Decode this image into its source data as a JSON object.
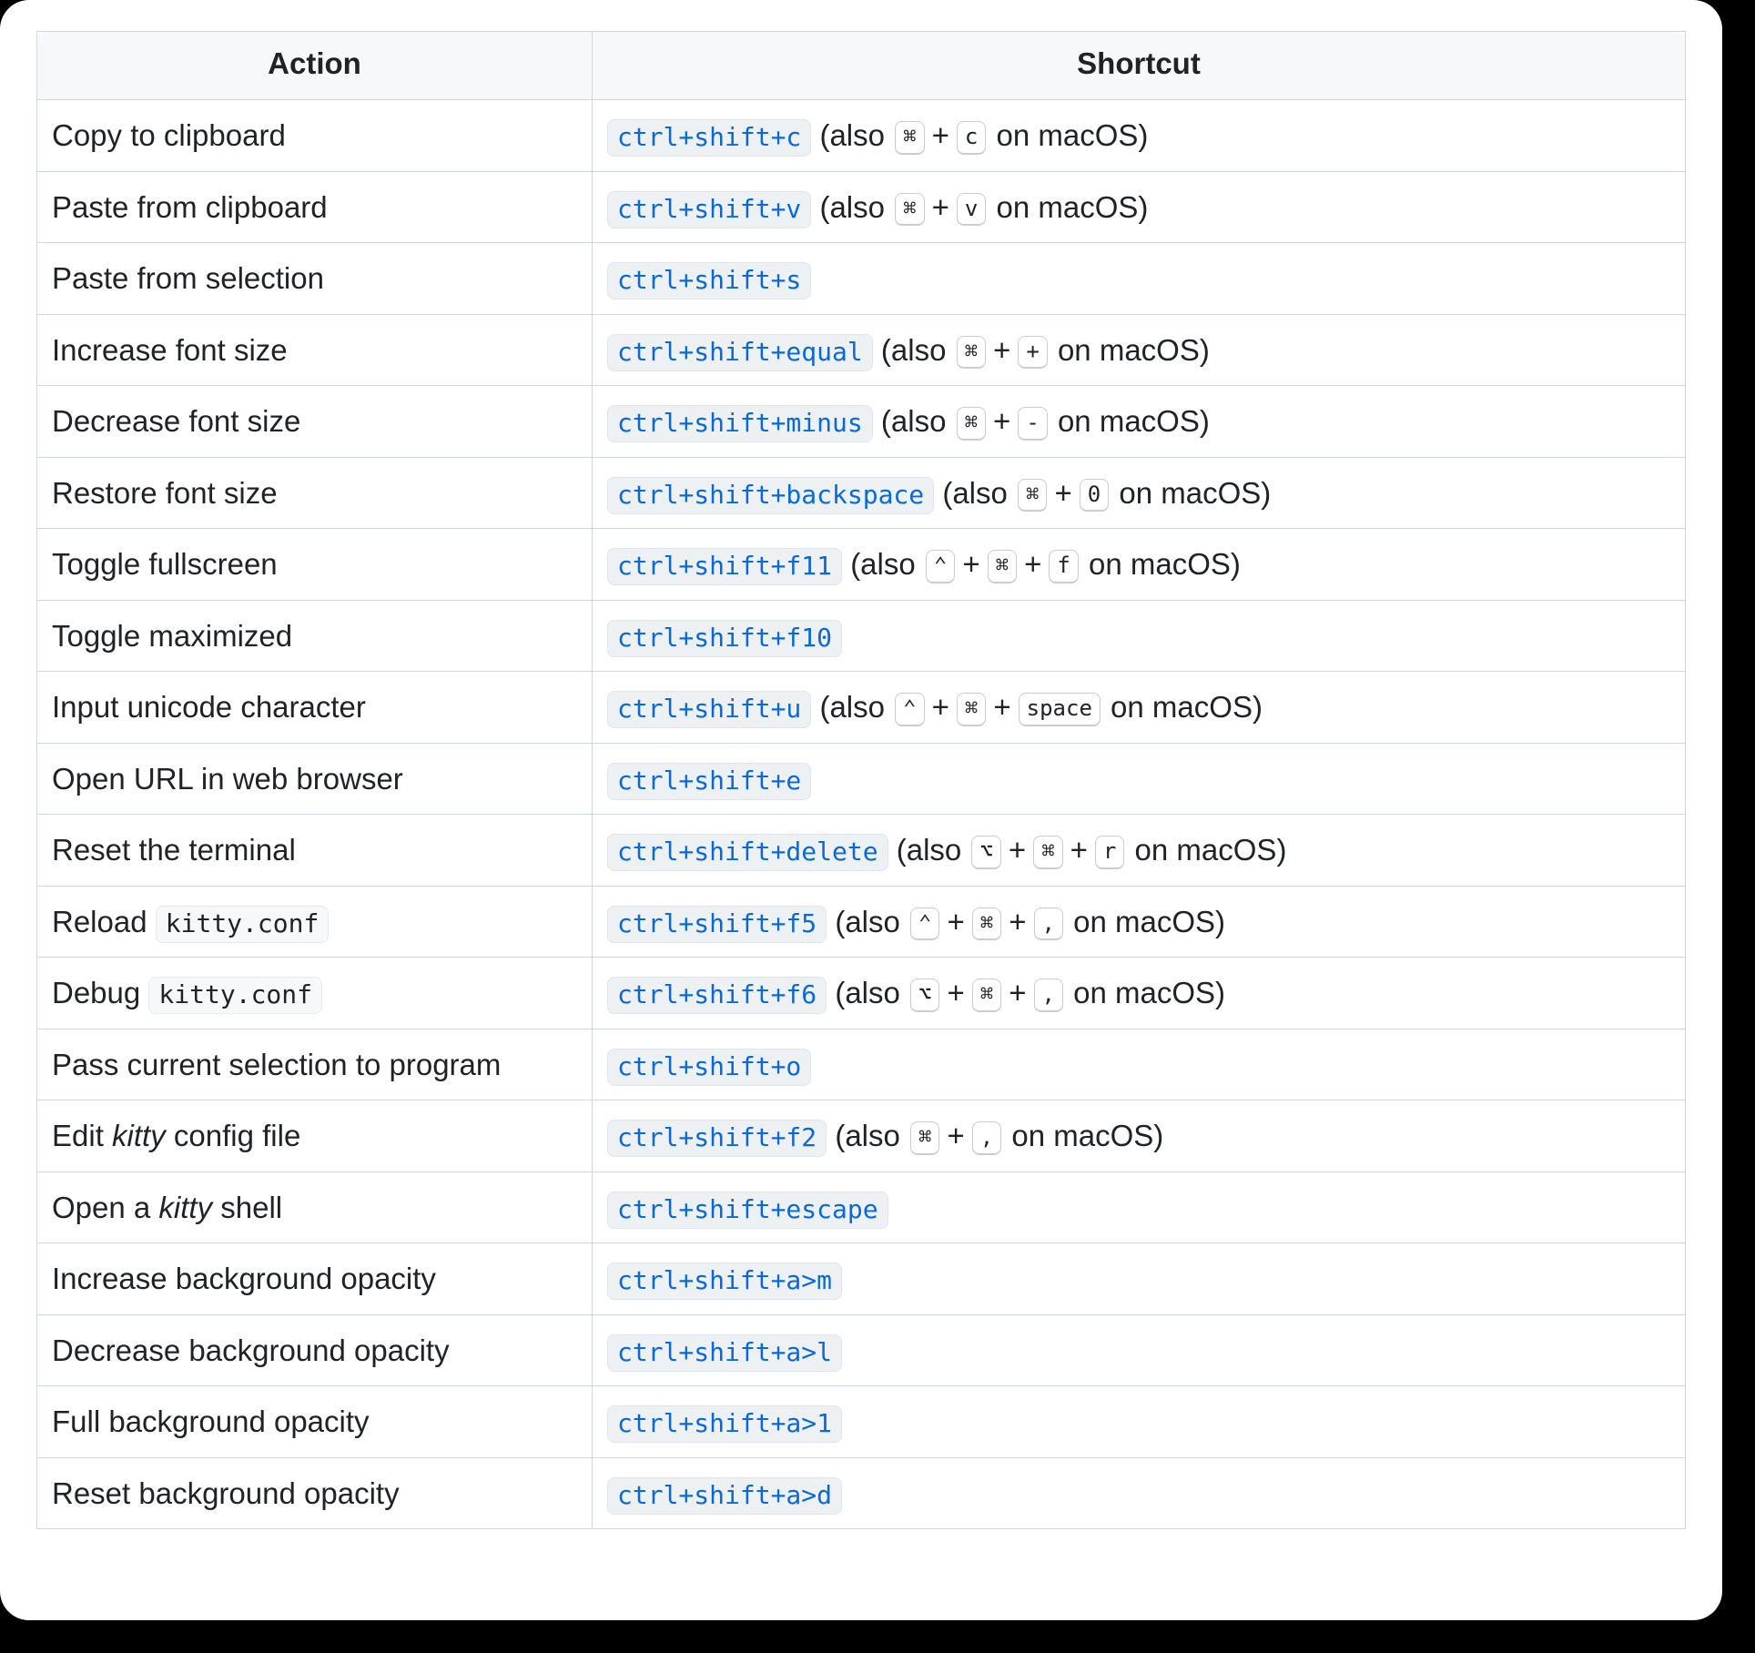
{
  "headers": {
    "action": "Action",
    "shortcut": "Shortcut"
  },
  "glyph": {
    "cmd": "⌘",
    "ctrl": "⌃",
    "opt": "⌥"
  },
  "text": {
    "also_prefix": "(also ",
    "on_macos_suffix": " on macOS)",
    "plus": "+"
  },
  "rows": [
    {
      "action": [
        {
          "t": "text",
          "v": "Copy to clipboard"
        }
      ],
      "primary": "ctrl+shift+c",
      "mac": [
        "cmd",
        "c"
      ]
    },
    {
      "action": [
        {
          "t": "text",
          "v": "Paste from clipboard"
        }
      ],
      "primary": "ctrl+shift+v",
      "mac": [
        "cmd",
        "v"
      ]
    },
    {
      "action": [
        {
          "t": "text",
          "v": "Paste from selection"
        }
      ],
      "primary": "ctrl+shift+s"
    },
    {
      "action": [
        {
          "t": "text",
          "v": "Increase font size"
        }
      ],
      "primary": "ctrl+shift+equal",
      "mac": [
        "cmd",
        "+"
      ]
    },
    {
      "action": [
        {
          "t": "text",
          "v": "Decrease font size"
        }
      ],
      "primary": "ctrl+shift+minus",
      "mac": [
        "cmd",
        "-"
      ]
    },
    {
      "action": [
        {
          "t": "text",
          "v": "Restore font size"
        }
      ],
      "primary": "ctrl+shift+backspace",
      "mac": [
        "cmd",
        "0"
      ]
    },
    {
      "action": [
        {
          "t": "text",
          "v": "Toggle fullscreen"
        }
      ],
      "primary": "ctrl+shift+f11",
      "mac": [
        "ctrl",
        "cmd",
        "f"
      ]
    },
    {
      "action": [
        {
          "t": "text",
          "v": "Toggle maximized"
        }
      ],
      "primary": "ctrl+shift+f10"
    },
    {
      "action": [
        {
          "t": "text",
          "v": "Input unicode character"
        }
      ],
      "primary": "ctrl+shift+u",
      "mac": [
        "ctrl",
        "cmd",
        "space"
      ]
    },
    {
      "action": [
        {
          "t": "text",
          "v": "Open URL in web browser"
        }
      ],
      "primary": "ctrl+shift+e"
    },
    {
      "action": [
        {
          "t": "text",
          "v": "Reset the terminal"
        }
      ],
      "primary": "ctrl+shift+delete",
      "mac": [
        "opt",
        "cmd",
        "r"
      ]
    },
    {
      "action": [
        {
          "t": "text",
          "v": "Reload "
        },
        {
          "t": "code",
          "v": "kitty.conf"
        }
      ],
      "primary": "ctrl+shift+f5",
      "mac": [
        "ctrl",
        "cmd",
        ","
      ]
    },
    {
      "action": [
        {
          "t": "text",
          "v": "Debug "
        },
        {
          "t": "code",
          "v": "kitty.conf"
        }
      ],
      "primary": "ctrl+shift+f6",
      "mac": [
        "opt",
        "cmd",
        ","
      ]
    },
    {
      "action": [
        {
          "t": "text",
          "v": "Pass current selection to program"
        }
      ],
      "primary": "ctrl+shift+o"
    },
    {
      "action": [
        {
          "t": "text",
          "v": "Edit "
        },
        {
          "t": "em",
          "v": "kitty"
        },
        {
          "t": "text",
          "v": " config file"
        }
      ],
      "primary": "ctrl+shift+f2",
      "mac": [
        "cmd",
        ","
      ]
    },
    {
      "action": [
        {
          "t": "text",
          "v": "Open a "
        },
        {
          "t": "em",
          "v": "kitty"
        },
        {
          "t": "text",
          "v": " shell"
        }
      ],
      "primary": "ctrl+shift+escape"
    },
    {
      "action": [
        {
          "t": "text",
          "v": "Increase background opacity"
        }
      ],
      "primary": "ctrl+shift+a>m"
    },
    {
      "action": [
        {
          "t": "text",
          "v": "Decrease background opacity"
        }
      ],
      "primary": "ctrl+shift+a>l"
    },
    {
      "action": [
        {
          "t": "text",
          "v": "Full background opacity"
        }
      ],
      "primary": "ctrl+shift+a>1"
    },
    {
      "action": [
        {
          "t": "text",
          "v": "Reset background opacity"
        }
      ],
      "primary": "ctrl+shift+a>d"
    }
  ]
}
